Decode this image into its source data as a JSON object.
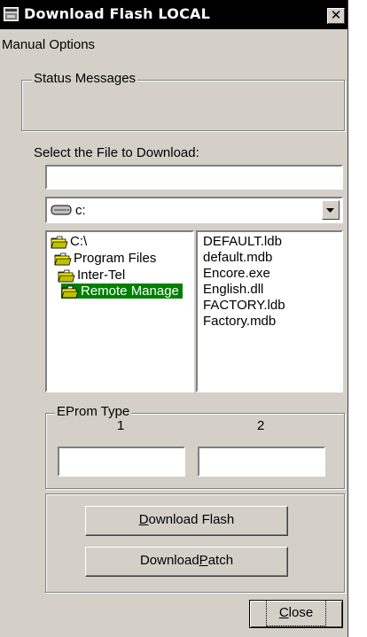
{
  "window": {
    "title": "Download Flash  LOCAL",
    "close_glyph": "✕"
  },
  "menu": {
    "items": [
      "Manual Options"
    ]
  },
  "status": {
    "label": "Status Messages",
    "text": ""
  },
  "file_select": {
    "label": "Select the  File to Download:",
    "filename_value": "",
    "drive": "c:"
  },
  "folders": [
    {
      "label": "C:\\",
      "selected": false
    },
    {
      "label": "Program Files",
      "selected": false
    },
    {
      "label": "Inter-Tel",
      "selected": false
    },
    {
      "label": "Remote Manage",
      "selected": true
    }
  ],
  "files": [
    "DEFAULT.ldb",
    "default.mdb",
    "Encore.exe",
    "English.dll",
    "FACTORY.ldb",
    "Factory.mdb"
  ],
  "eprom": {
    "label": "EProm Type",
    "col1": "1",
    "col2": "2",
    "value1": "",
    "value2": ""
  },
  "buttons": {
    "download_flash": {
      "prefix": "",
      "accel": "D",
      "rest": "ownload Flash"
    },
    "download_patch": {
      "prefix": "Download ",
      "accel": "P",
      "rest": "atch"
    },
    "close": {
      "prefix": "",
      "accel": "C",
      "rest": "lose"
    }
  },
  "colors": {
    "selection": "#008000",
    "titlebar": "#000000",
    "face": "#d4d0c8"
  }
}
